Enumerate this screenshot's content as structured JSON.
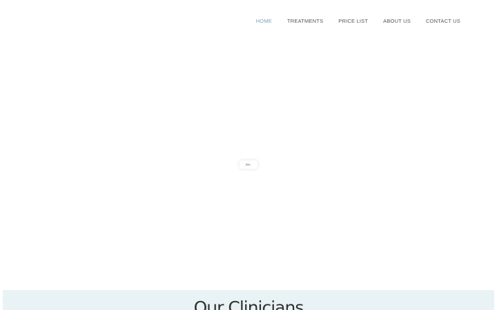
{
  "nav": {
    "items": [
      {
        "label": "HOME",
        "active": true
      },
      {
        "label": "TREATMENTS",
        "active": false
      },
      {
        "label": "PRICE LIST",
        "active": false
      },
      {
        "label": "ABOUT US",
        "active": false
      },
      {
        "label": "CONTACT US",
        "active": false
      }
    ]
  },
  "loader": {
    "icon": "loading-spinner-icon"
  },
  "clinicians": {
    "title": "Our Clinicians"
  },
  "colors": {
    "nav_active": "#7da0b3",
    "nav_text": "#555555",
    "band_background": "#e9f2f5",
    "heading_text": "#333333"
  }
}
